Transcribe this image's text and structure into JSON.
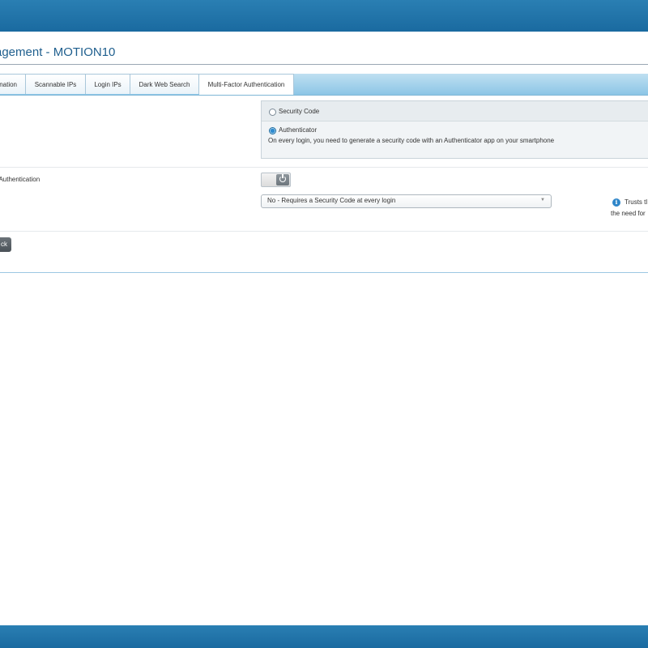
{
  "header": {
    "title": "agement - MOTION10"
  },
  "tabs": [
    {
      "label": "nation"
    },
    {
      "label": "Scannable IPs"
    },
    {
      "label": "Login IPs"
    },
    {
      "label": "Dark Web Search"
    },
    {
      "label": "Multi-Factor Authentication",
      "active": true
    }
  ],
  "mfa_method": {
    "options": [
      {
        "label": "Security Code",
        "selected": false
      },
      {
        "label": "Authenticator",
        "selected": true
      }
    ],
    "description": "On every login, you need to generate a security code with an Authenticator app on your smartphone"
  },
  "trust_section": {
    "label": "r Authentication",
    "toggle_state": "off",
    "select_value": "No - Requires a Security Code at every login",
    "info_line1": "Trusts tl",
    "info_line2": "the need for"
  },
  "back_button": {
    "label": "ck"
  },
  "colors": {
    "brand_bar": "#1f73aa",
    "title": "#1f5f8e",
    "tab_strip": "#a6d2eb"
  }
}
